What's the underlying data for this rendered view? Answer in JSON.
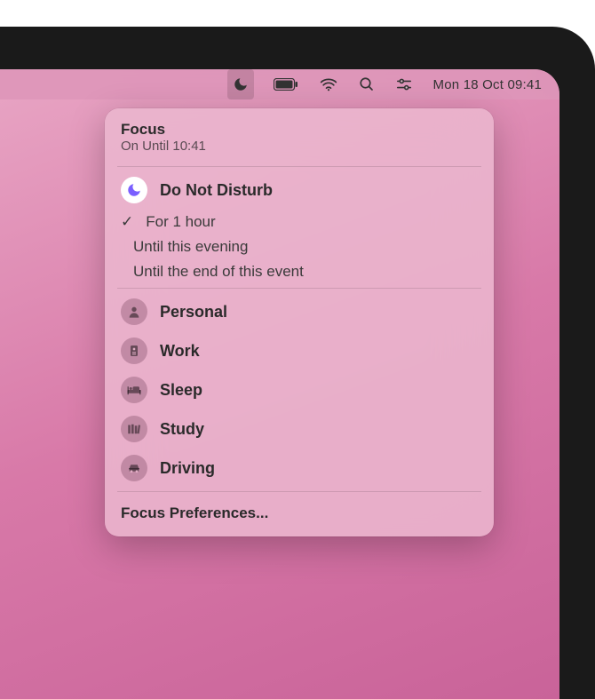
{
  "menubar": {
    "datetime": "Mon 18 Oct  09:41"
  },
  "panel": {
    "title": "Focus",
    "subtitle": "On Until 10:41",
    "dnd": {
      "label": "Do Not Disturb",
      "options": [
        {
          "label": "For 1 hour",
          "selected": true
        },
        {
          "label": "Until this evening",
          "selected": false
        },
        {
          "label": "Until the end of this event",
          "selected": false
        }
      ]
    },
    "modes": [
      {
        "label": "Personal",
        "icon": "person"
      },
      {
        "label": "Work",
        "icon": "badge"
      },
      {
        "label": "Sleep",
        "icon": "bed"
      },
      {
        "label": "Study",
        "icon": "books"
      },
      {
        "label": "Driving",
        "icon": "car"
      }
    ],
    "footer": "Focus Preferences..."
  }
}
